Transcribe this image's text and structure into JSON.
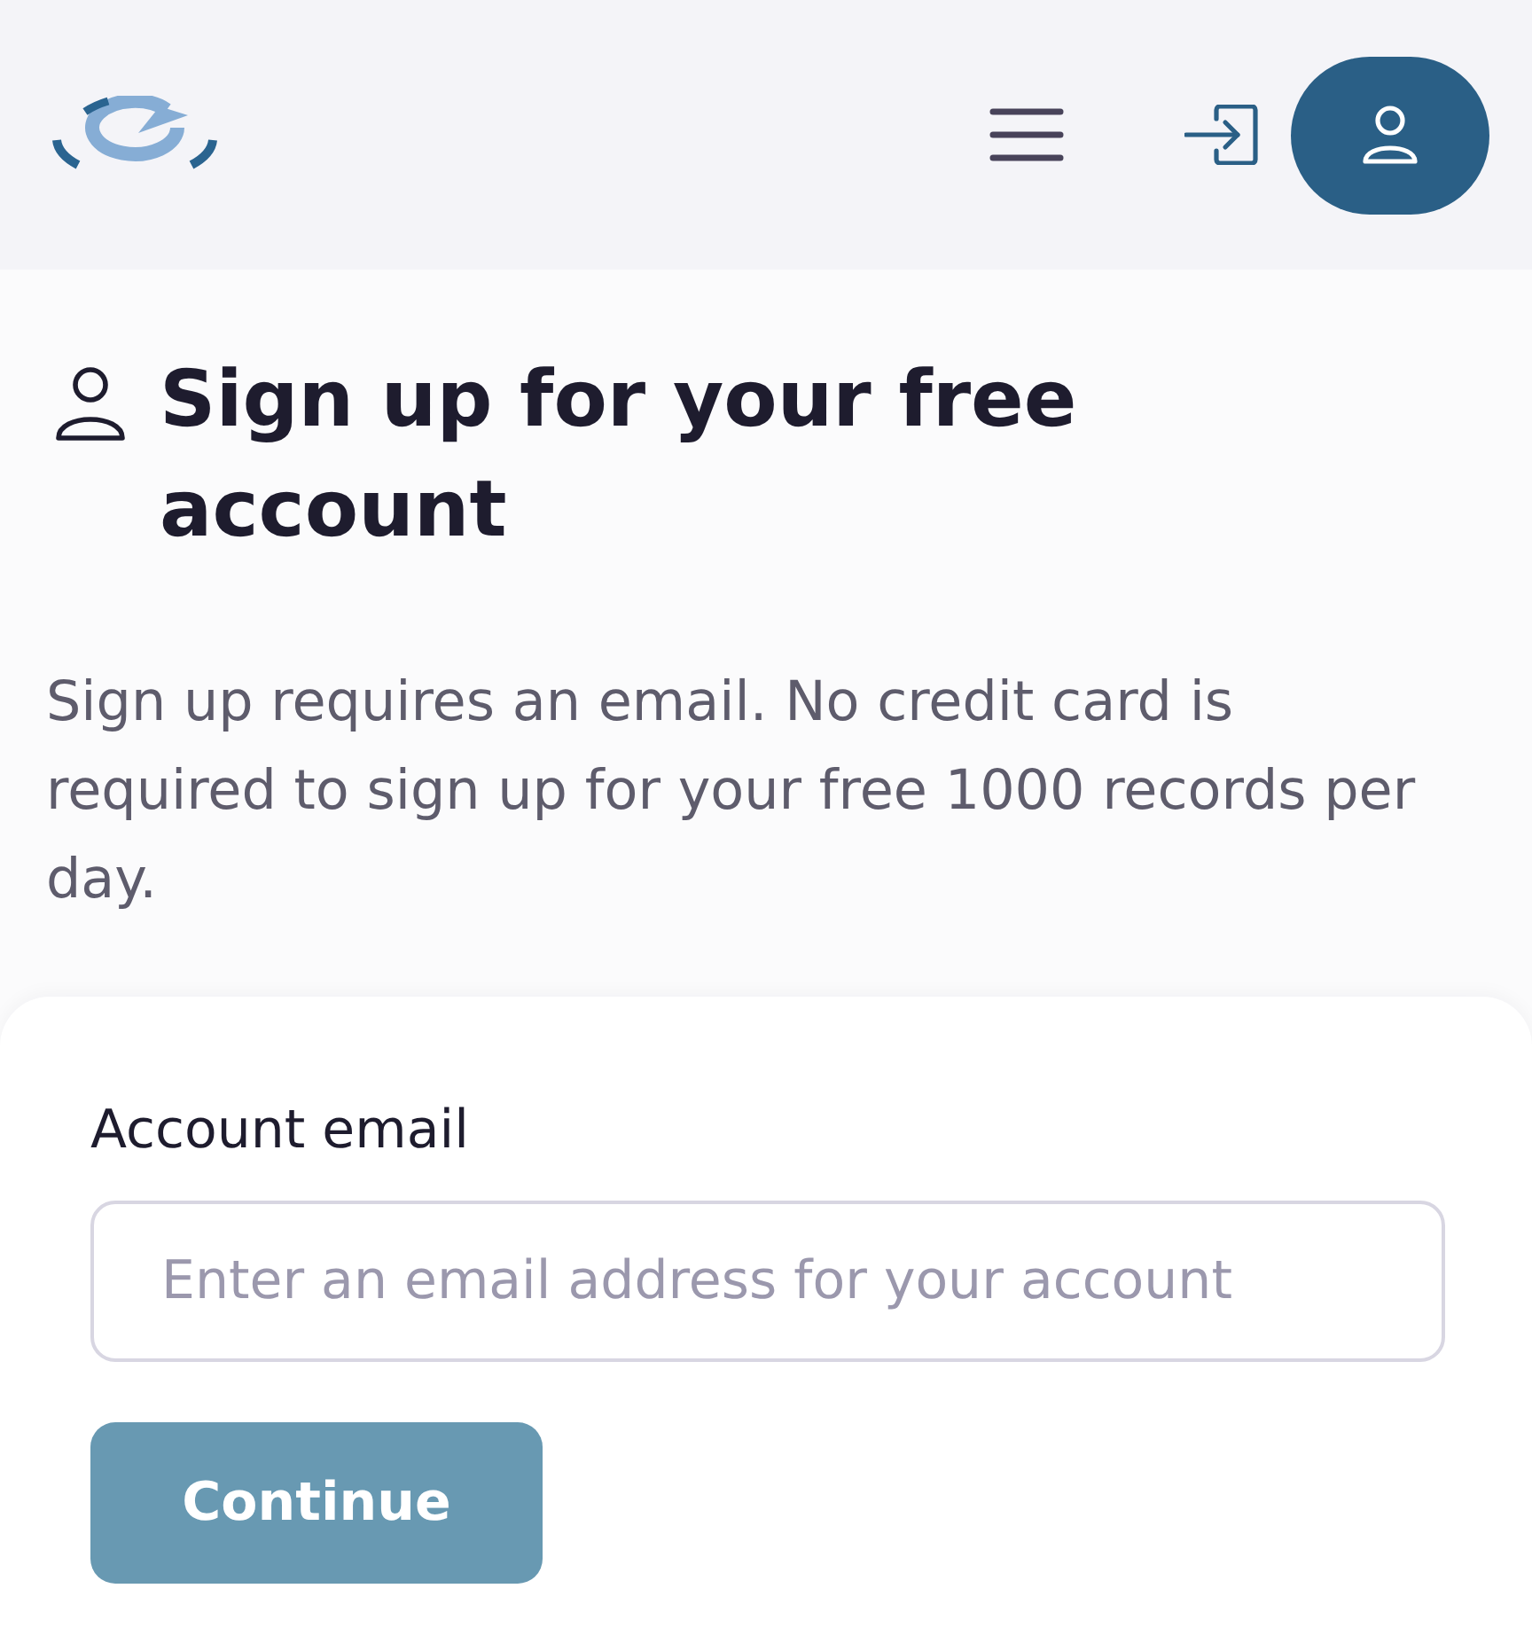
{
  "page": {
    "title": "Sign up for your free account",
    "description": "Sign up requires an email. No credit card is required to sign up for your free 1000 records per day."
  },
  "form": {
    "email_field": {
      "label": "Account email",
      "placeholder": "Enter an email address for your account"
    },
    "submit_button": {
      "label": "Continue",
      "disabled": true
    }
  }
}
